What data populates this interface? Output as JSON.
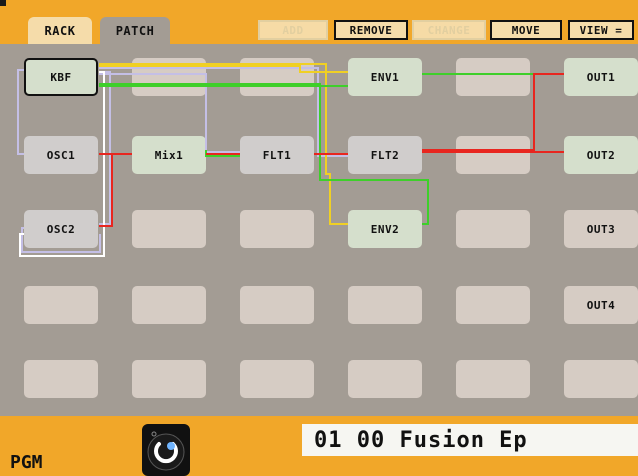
{
  "tabs": [
    {
      "label": "RACK",
      "active": false
    },
    {
      "label": "PATCH",
      "active": true
    }
  ],
  "toolbar": {
    "add": "ADD",
    "remove": "REMOVE",
    "change": "CHANGE",
    "move": "MOVE",
    "view": "VIEW ="
  },
  "modules": {
    "kbf": "KBF",
    "env1": "ENV1",
    "out1": "OUT1",
    "osc1": "OSC1",
    "mix1": "Mix1",
    "flt1": "FLT1",
    "flt2": "FLT2",
    "out2": "OUT2",
    "osc2": "OSC2",
    "env2": "ENV2",
    "out3": "OUT3",
    "out4": "OUT4"
  },
  "colors": {
    "accent": "#f1a729",
    "grid_bg": "#a39c94",
    "wire_red": "#e8261f",
    "wire_green": "#3ecf2a",
    "wire_yellow": "#f0d024",
    "wire_lavender": "#c4bfe6",
    "wire_white": "#ffffff"
  },
  "footer": {
    "mode_label": "PGM",
    "program_name": "01 00 Fusion Ep",
    "knob_icon": "rotary-knob-icon"
  }
}
